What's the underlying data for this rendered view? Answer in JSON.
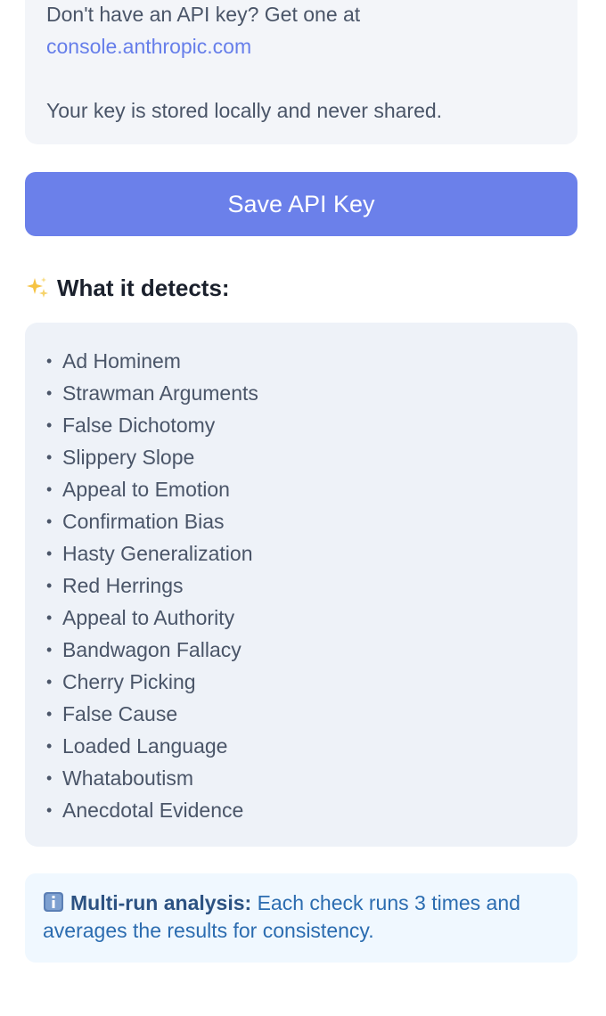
{
  "api_info": {
    "line1": "Don't have an API key? Get one at",
    "link": "console.anthropic.com",
    "privacy": "Your key is stored locally and never shared."
  },
  "save_button": {
    "label": "Save API Key"
  },
  "detects": {
    "icon": "sparkles-icon",
    "title": "What it detects:",
    "items": [
      "Ad Hominem",
      "Strawman Arguments",
      "False Dichotomy",
      "Slippery Slope",
      "Appeal to Emotion",
      "Confirmation Bias",
      "Hasty Generalization",
      "Red Herrings",
      "Appeal to Authority",
      "Bandwagon Fallacy",
      "Cherry Picking",
      "False Cause",
      "Loaded Language",
      "Whataboutism",
      "Anecdotal Evidence"
    ]
  },
  "note": {
    "icon": "info-icon",
    "bold": "Multi-run analysis:",
    "text": " Each check runs 3 times and averages the results for consistency."
  },
  "colors": {
    "accent": "#667eea",
    "button": "#6b80ea",
    "card": "#f3f5f9",
    "note_bg": "#f0f8ff",
    "note_text": "#2b6cb0"
  }
}
